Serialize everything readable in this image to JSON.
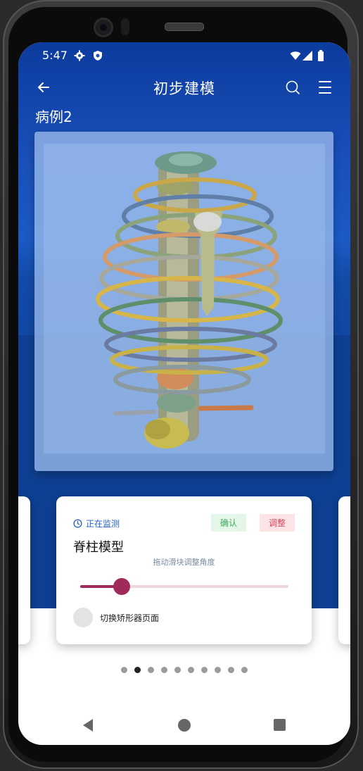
{
  "status_bar": {
    "time": "5:47"
  },
  "app_bar": {
    "title": "初步建模"
  },
  "case_label": "病例2",
  "card": {
    "monitor_text": "正在监测",
    "confirm_label": "确认",
    "adjust_label": "调整",
    "title": "脊柱模型",
    "slider_hint": "拖动滑块调整角度",
    "slider_value_percent": 20,
    "toggle_label": "切换矫形器页面"
  },
  "pager": {
    "count": 10,
    "active_index": 1
  },
  "colors": {
    "header_blue": "#1a4fb8",
    "accent_magenta": "#a12a5c",
    "confirm_green": "#3caa58",
    "adjust_red": "#d34a5e",
    "monitor_blue": "#1f5ebf"
  }
}
